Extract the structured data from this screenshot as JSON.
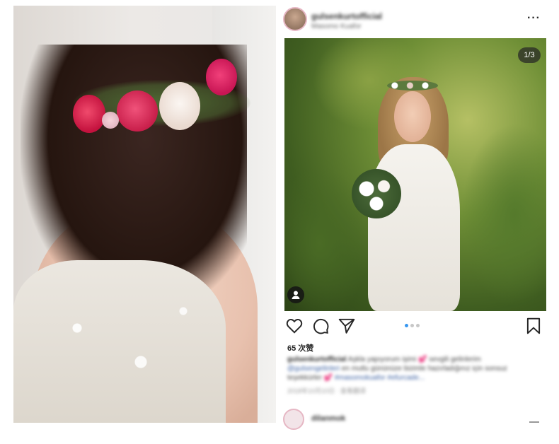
{
  "post": {
    "username": "gulsenkurtofficial",
    "location": "Masomo Kuafor",
    "more_label": "···",
    "image_counter": "1/3",
    "likes": "65 次赞",
    "caption": {
      "username": "gulsenkurtofficial",
      "text": " Aşkla yapıyorum işimi 💕 sevgili gelinlerim ",
      "mention": "@gulsengelinleri",
      "text2": " en mutlu gününüze bizimle hazırladığınız için sonsuz teşekkürler 💕 ",
      "hashtags": "#masomokuafor #efurcade..."
    },
    "time": "2018年10月10日 · 查看翻译",
    "comment_username": "dilanmok",
    "carousel": {
      "count": 3,
      "active": 0
    }
  },
  "colors": {
    "dot_active": "#3897f0",
    "dot_inactive": "#c7c7c7",
    "icon_stroke": "#262626"
  },
  "icons": [
    "more-icon",
    "heart-icon",
    "comment-icon",
    "share-icon",
    "bookmark-icon",
    "user-tag-icon"
  ]
}
